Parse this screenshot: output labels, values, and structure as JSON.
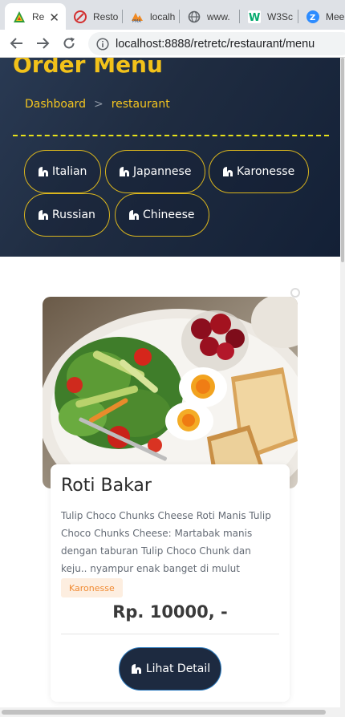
{
  "browser": {
    "tabs": [
      {
        "title": "Re",
        "favicon": "restaurant-logo-icon",
        "active": true
      },
      {
        "title": "Resto",
        "favicon": "opera-icon",
        "active": false
      },
      {
        "title": "localh",
        "favicon": "phpmyadmin-icon",
        "active": false
      },
      {
        "title": "www.",
        "favicon": "globe-icon",
        "active": false
      },
      {
        "title": "W3Sc",
        "favicon": "w3schools-icon",
        "active": false
      },
      {
        "title": "Mee",
        "favicon": "zoom-icon",
        "active": false
      }
    ],
    "close_glyph": "✕",
    "url": "localhost:8888/retretc/restaurant/menu"
  },
  "hero": {
    "title": "Order Menu",
    "breadcrumb": {
      "home": "Dashboard",
      "separator": ">",
      "current": "restaurant"
    }
  },
  "categories": [
    {
      "label": "Italian"
    },
    {
      "label": "Japannese"
    },
    {
      "label": "Karonesse"
    },
    {
      "label": "Russian"
    },
    {
      "label": "Chineese"
    }
  ],
  "menu_card": {
    "title": "Roti Bakar",
    "description": "Tulip Choco Chunks Cheese Roti Manis Tulip Choco Chunks Cheese: Martabak manis dengan taburan Tulip Choco Chunk dan keju.. nyampur enak banget di mulut",
    "category_badge": "Karonesse",
    "price": "Rp. 10000, -",
    "detail_button": "Lihat Detail"
  },
  "colors": {
    "hero_bg": "#1f2c41",
    "accent_yellow": "#f2c21a",
    "badge_bg": "#fdeee0",
    "badge_text": "#f08a32",
    "button_bg": "#1d2a40"
  }
}
